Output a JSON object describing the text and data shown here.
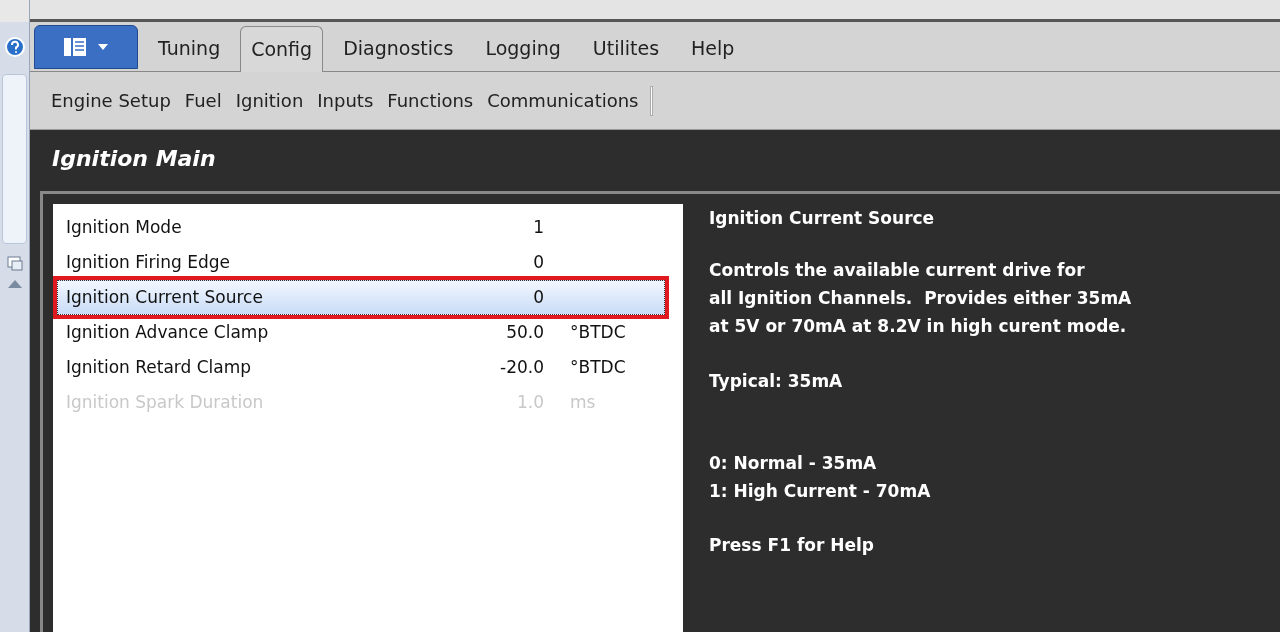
{
  "ribbon": {
    "tabs": [
      {
        "label": "Tuning",
        "selected": false
      },
      {
        "label": "Config",
        "selected": true
      },
      {
        "label": "Diagnostics",
        "selected": false
      },
      {
        "label": "Logging",
        "selected": false
      },
      {
        "label": "Utilites",
        "selected": false
      },
      {
        "label": "Help",
        "selected": false
      }
    ]
  },
  "toolbar": {
    "items": [
      "Engine Setup",
      "Fuel",
      "Ignition",
      "Inputs",
      "Functions",
      "Communications"
    ]
  },
  "page": {
    "title": "Ignition Main"
  },
  "settings": [
    {
      "name": "Ignition Mode",
      "value": "1",
      "selected": false,
      "disabled": false,
      "highlighted": false
    },
    {
      "name": "Ignition Firing Edge",
      "value": "0",
      "selected": false,
      "disabled": false,
      "highlighted": false
    },
    {
      "name": "Ignition Current Source",
      "value": "0",
      "selected": true,
      "disabled": false,
      "highlighted": true
    },
    {
      "name": "Ignition Advance Clamp",
      "value": "50.0",
      "unit": "°BTDC",
      "selected": false,
      "disabled": false,
      "highlighted": false
    },
    {
      "name": "Ignition Retard Clamp",
      "value": "-20.0",
      "unit": "°BTDC",
      "selected": false,
      "disabled": false,
      "highlighted": false
    },
    {
      "name": "Ignition Spark Duration",
      "value": "1.0",
      "unit": "ms",
      "selected": false,
      "disabled": true,
      "highlighted": false
    }
  ],
  "help": {
    "title": "Ignition Current Source",
    "description": [
      "Controls the available current drive for",
      "all Ignition Channels.  Provides either 35mA",
      "at 5V or 70mA at 8.2V in high curent mode."
    ],
    "typical": "Typical: 35mA",
    "options": [
      "0: Normal - 35mA",
      "1: High Current - 70mA"
    ],
    "footer": "Press F1 for Help"
  }
}
